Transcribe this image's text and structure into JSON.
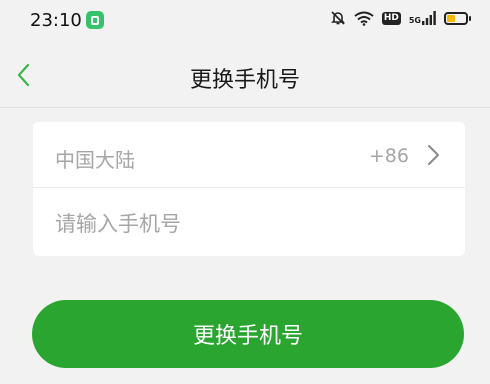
{
  "status_bar": {
    "time": "23:10",
    "network_badge": "HD",
    "signal_label": "5G",
    "icons": [
      "app-notification-icon",
      "mute-bell-icon",
      "wifi-icon",
      "hd-icon",
      "signal-icon",
      "battery-icon"
    ]
  },
  "header": {
    "title": "更换手机号",
    "back_icon": "chevron-left-icon"
  },
  "form": {
    "region_name": "中国大陆",
    "region_code": "+86",
    "phone_placeholder": "请输入手机号",
    "phone_value": ""
  },
  "actions": {
    "submit_label": "更换手机号"
  },
  "colors": {
    "accent": "#2aa630",
    "back_icon": "#3cb54a",
    "background": "#f2f2f2",
    "placeholder": "#a6a6a6"
  }
}
